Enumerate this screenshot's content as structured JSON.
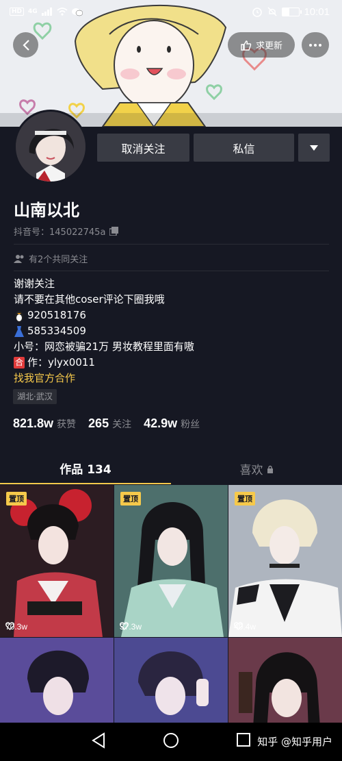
{
  "status_bar": {
    "network": "4G",
    "time": "10:01"
  },
  "header": {
    "update_label": "求更新"
  },
  "profile": {
    "unfollow_label": "取消关注",
    "message_label": "私信",
    "name": "山南以北",
    "douyin_id": "抖音号：145022745a",
    "mutual_follow": "有2个共同关注",
    "bio": [
      "谢谢关注",
      "请不要在其他coser评论下圈我哦",
      "920518176",
      "585334509",
      "小号：网恋被骗21万 男妆教程里面有嗷",
      "作：ylyx0011",
      "找我官方合作"
    ],
    "bio_tag_char": "合",
    "location": "湖北·武汉",
    "stats": {
      "likes_value": "821.8w",
      "likes_label": "获赞",
      "following_value": "265",
      "following_label": "关注",
      "followers_value": "42.9w",
      "followers_label": "粉丝"
    }
  },
  "tabs": {
    "works_label": "作品 134",
    "likes_label": "喜欢"
  },
  "grid": {
    "pin_label": "置顶",
    "items": [
      {
        "likes": "70.3w",
        "pinned": true,
        "bg": "#b73040"
      },
      {
        "likes": "37.3w",
        "pinned": true,
        "bg": "#5f8c86"
      },
      {
        "likes": "40.4w",
        "pinned": true,
        "bg": "#c9cfd6"
      },
      {
        "likes": "",
        "pinned": false,
        "bg": "#5a4c9a"
      },
      {
        "likes": "",
        "pinned": false,
        "bg": "#4c4a92"
      },
      {
        "likes": "",
        "pinned": false,
        "bg": "#7a3a3a"
      }
    ]
  },
  "watermark": "知乎 @知乎用户",
  "colors": {
    "background": "#161823",
    "accent": "#f6c94b",
    "button": "#393b44",
    "muted_text": "#8a8b91"
  }
}
